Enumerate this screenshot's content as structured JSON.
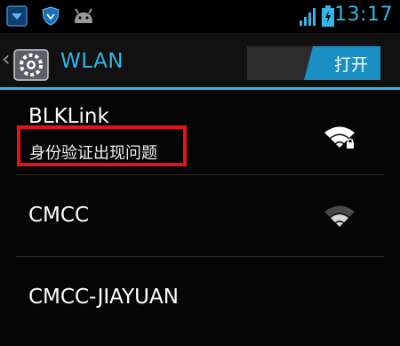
{
  "status_bar": {
    "time": "13:17",
    "left_icons": [
      "shield-app-icon",
      "heart-shield-app-icon",
      "android-icon"
    ],
    "right_icons": [
      "signal-icon",
      "battery-charging-icon"
    ]
  },
  "action_bar": {
    "back_glyph": "‹",
    "title": "WLAN",
    "toggle_label": "打开",
    "toggle_state": "on",
    "accent_color": "#33b5e5"
  },
  "networks": [
    {
      "ssid": "BLKLink",
      "summary": "身份验证出现问题",
      "signal": "strong",
      "secured": true,
      "highlighted": true
    },
    {
      "ssid": "CMCC",
      "signal": "medium",
      "secured": false
    },
    {
      "ssid": "CMCC-JIAYUAN"
    }
  ],
  "highlight_color": "#e0151b"
}
